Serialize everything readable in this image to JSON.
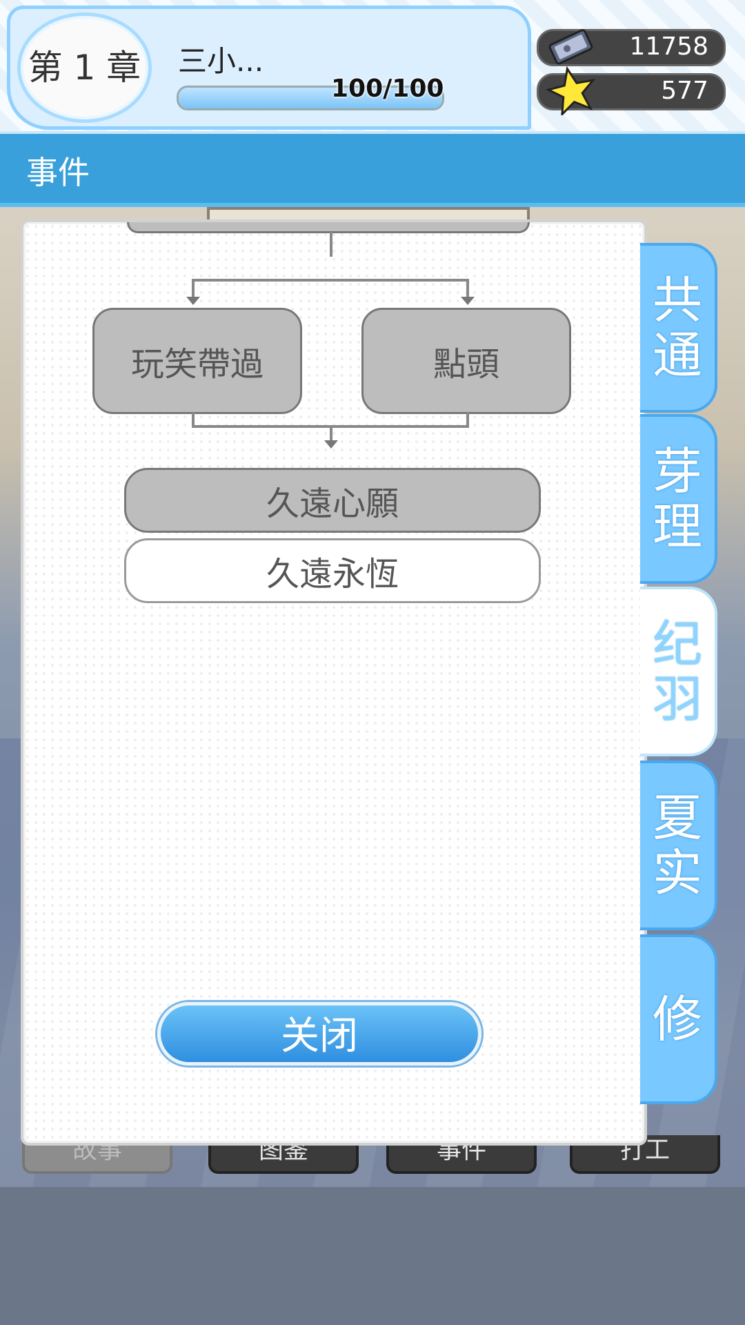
{
  "header": {
    "chapter": "第 1 章",
    "player_name": "三小...",
    "exp_text": "100/100",
    "exp_progress": 1.0,
    "currencies": [
      {
        "icon": "ticket-icon",
        "value": "11758"
      },
      {
        "icon": "star-icon",
        "value": "577"
      }
    ]
  },
  "title": "事件",
  "flow": {
    "nodes": [
      {
        "label": "玩笑帶過",
        "state": "visited"
      },
      {
        "label": "點頭",
        "state": "visited"
      },
      {
        "label": "久遠心願",
        "state": "visited"
      },
      {
        "label": "久遠永恆",
        "state": "unvisited"
      }
    ]
  },
  "close_label": "关闭",
  "tabs": [
    {
      "label": "共通",
      "active": false
    },
    {
      "label": "芽理",
      "active": false
    },
    {
      "label": "纪羽",
      "active": true
    },
    {
      "label": "夏实",
      "active": false
    },
    {
      "label": "修",
      "active": false
    }
  ],
  "bottom_nav": [
    "故事",
    "图鉴",
    "事件",
    "打工"
  ],
  "colors": {
    "accent": "#3aa0db",
    "tab": "#79c8ff",
    "visited_node": "#bdbdbd"
  }
}
